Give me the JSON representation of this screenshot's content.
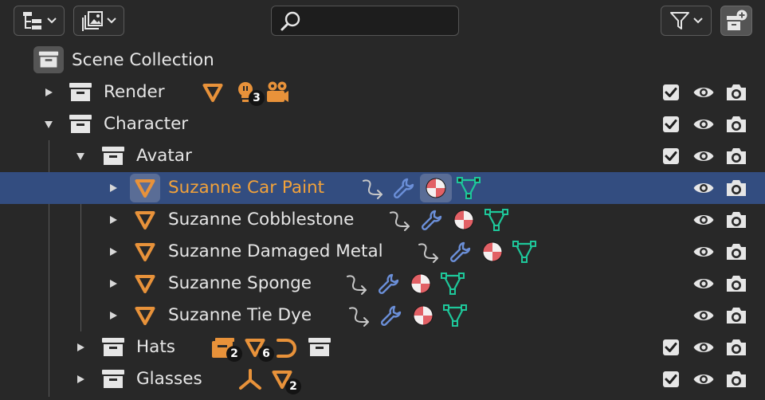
{
  "header": {
    "display_mode_icon": "outliner-display-mode-icon",
    "filter_view_icon": "view-layer-filter-icon",
    "search": {
      "value": "",
      "placeholder": ""
    },
    "filter_icon": "filter-funnel-icon",
    "new_collection_icon": "new-collection-icon"
  },
  "tree": {
    "root": {
      "label": "Scene Collection"
    },
    "rows": [
      {
        "id": "render",
        "label": "Render",
        "expanded": false,
        "depth": 1,
        "icons": [
          "mesh-object-icon",
          "light-icon",
          "camera-icon"
        ],
        "light_count": "3",
        "checkbox": true
      },
      {
        "id": "character",
        "label": "Character",
        "expanded": true,
        "depth": 1,
        "icons": [],
        "checkbox": true
      },
      {
        "id": "avatar",
        "label": "Avatar",
        "expanded": true,
        "depth": 2,
        "icons": [],
        "checkbox": true
      },
      {
        "id": "suzanne-car-paint",
        "label": "Suzanne Car Paint",
        "selected": true,
        "depth": 3,
        "icons": [
          "constraint-icon",
          "modifier-wrench-icon",
          "material-icon",
          "mesh-data-icon"
        ]
      },
      {
        "id": "suzanne-cobblestone",
        "label": "Suzanne Cobblestone",
        "depth": 3,
        "icons": [
          "constraint-icon",
          "modifier-wrench-icon",
          "material-icon",
          "mesh-data-icon"
        ]
      },
      {
        "id": "suzanne-damaged-metal",
        "label": "Suzanne Damaged Metal",
        "depth": 3,
        "icons": [
          "constraint-icon",
          "modifier-wrench-icon",
          "material-icon",
          "mesh-data-icon"
        ]
      },
      {
        "id": "suzanne-sponge",
        "label": "Suzanne Sponge",
        "depth": 3,
        "icons": [
          "constraint-icon",
          "modifier-wrench-icon",
          "material-icon",
          "mesh-data-icon"
        ]
      },
      {
        "id": "suzanne-tie-dye",
        "label": "Suzanne Tie Dye",
        "depth": 3,
        "icons": [
          "constraint-icon",
          "modifier-wrench-icon",
          "material-icon",
          "mesh-data-icon"
        ]
      },
      {
        "id": "hats",
        "label": "Hats",
        "expanded": false,
        "depth": 2,
        "icons": [
          "collection-instance-icon",
          "mesh-object-icon",
          "curve-icon",
          "collection-icon"
        ],
        "instance_count": "2",
        "mesh_count": "6",
        "checkbox": true
      },
      {
        "id": "glasses",
        "label": "Glasses",
        "expanded": false,
        "depth": 2,
        "icons": [
          "empty-axes-icon",
          "mesh-object-icon"
        ],
        "mesh_count": "2",
        "checkbox": true
      }
    ]
  },
  "colors": {
    "background": "#282828",
    "selected_row": "#334d80",
    "selected_text": "#f2a23a",
    "object_orange": "#e8923a",
    "modifier_blue": "#6b8fd8",
    "material_red": "#e26065",
    "mesh_green": "#1ec79a"
  }
}
